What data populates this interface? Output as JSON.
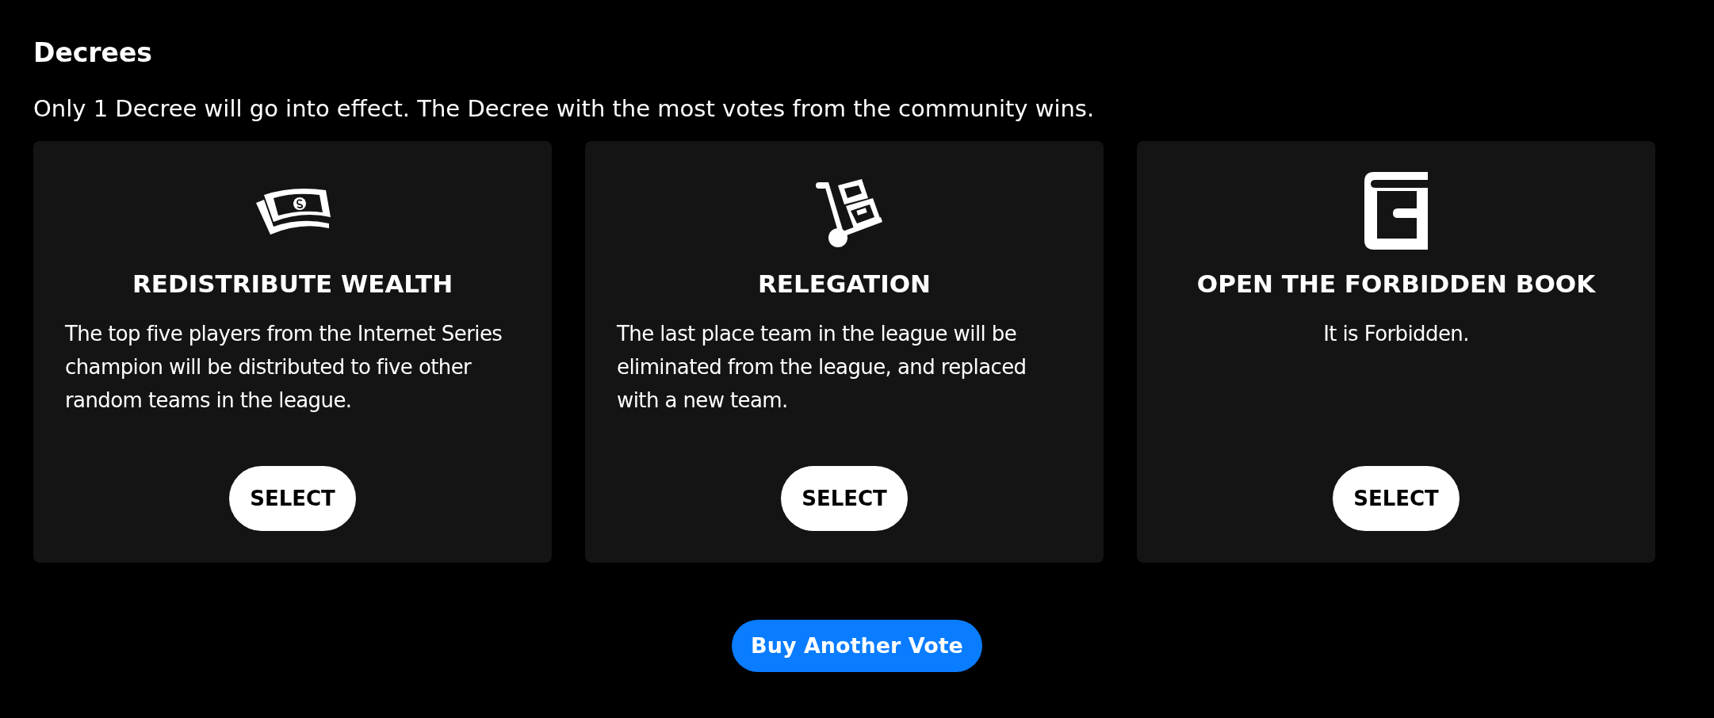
{
  "title": "Decrees",
  "subtitle": "Only 1 Decree will go into effect. The Decree with the most votes from the community wins.",
  "decrees": [
    {
      "name": "REDISTRIBUTE WEALTH",
      "description": "The top five players from the Internet Series champion will be distributed to five other random teams in the league.",
      "button": "SELECT"
    },
    {
      "name": "RELEGATION",
      "description": "The last place team in the league will be eliminated from the league, and replaced with a new team.",
      "button": "SELECT"
    },
    {
      "name": "OPEN THE FORBIDDEN BOOK",
      "description": "It is Forbidden.",
      "button": "SELECT"
    }
  ],
  "buy_button": "Buy Another Vote"
}
